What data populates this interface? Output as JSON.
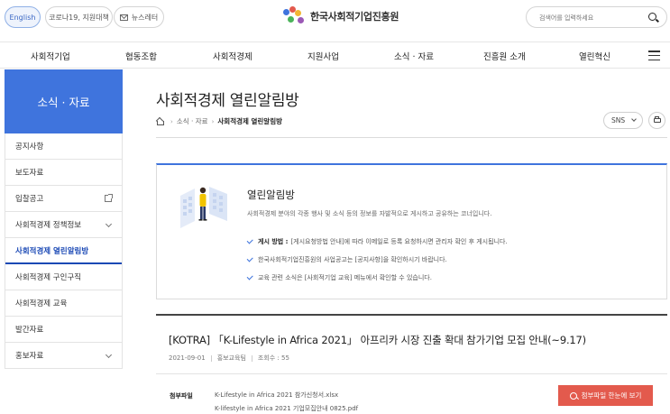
{
  "topbar": {
    "lang_label": "English",
    "covid_label": "코로나19, 지원대책",
    "newsletter_label": "뉴스레터",
    "logo_text": "한국사회적기업진흥원",
    "search": {
      "placeholder": "검색어를 입력하세요"
    }
  },
  "gnb": {
    "items": [
      "사회적기업",
      "협동조합",
      "사회적경제",
      "지원사업",
      "소식 · 자료",
      "진흥원 소개",
      "열린혁신"
    ]
  },
  "sidebar": {
    "title": "소식 · 자료",
    "items": [
      {
        "label": "공지사항"
      },
      {
        "label": "보도자료"
      },
      {
        "label": "입찰공고"
      },
      {
        "label": "사회적경제 정책정보"
      },
      {
        "label": "사회적경제 열린알림방"
      },
      {
        "label": "사회적경제 구인구직"
      },
      {
        "label": "사회적경제 교육"
      },
      {
        "label": "발간자료"
      },
      {
        "label": "홍보자료"
      }
    ]
  },
  "page": {
    "title": "사회적경제 열린알림방",
    "breadcrumb": [
      "소식 · 자료",
      "사회적경제 열린알림방"
    ],
    "sns_label": "SNS"
  },
  "info": {
    "title": "열린알림방",
    "desc": "사회적경제 분야의 각종 행사 및 소식 등의 정보를 자발적으로 게시하고 공유하는 코너입니다.",
    "items": [
      {
        "strong": "게시 방법 :",
        "text": "[게시요청방법 안내]에 따라 이메일로 등록 요청하시면 관리자 확인 후 게시됩니다."
      },
      {
        "strong": "",
        "text": "한국사회적기업진흥원의 사업공고는 [공지사항]을 확인하시기 바랍니다."
      },
      {
        "strong": "",
        "text": "교육 관련 소식은 [사회적기업 교육] 메뉴에서 확인할 수 있습니다."
      }
    ]
  },
  "post": {
    "title": "[KOTRA] 「K-Lifestyle in Africa 2021」 아프리카 시장 진출 확대 참가기업 모집 안내(~9.17)",
    "date": "2021-09-01",
    "dept": "홍보교육팀",
    "views": "조회수 : 55",
    "attach_label": "첨부파일",
    "files": [
      "K-Lifestyle in Africa 2021 참가신청서.xlsx",
      "K-lifestyle in Africa 2021 기업모집안내 0825.pdf"
    ],
    "preview_label": "첨부파일 한눈에 보기"
  },
  "colors": {
    "primary": "#3f74dd",
    "accent_red": "#e35a4d",
    "active_text": "#1b49b5"
  },
  "icons": [
    "mail-icon",
    "search-icon",
    "hamburger-icon",
    "home-icon",
    "chevron-down-icon",
    "external-link-icon",
    "print-icon",
    "check-icon"
  ]
}
